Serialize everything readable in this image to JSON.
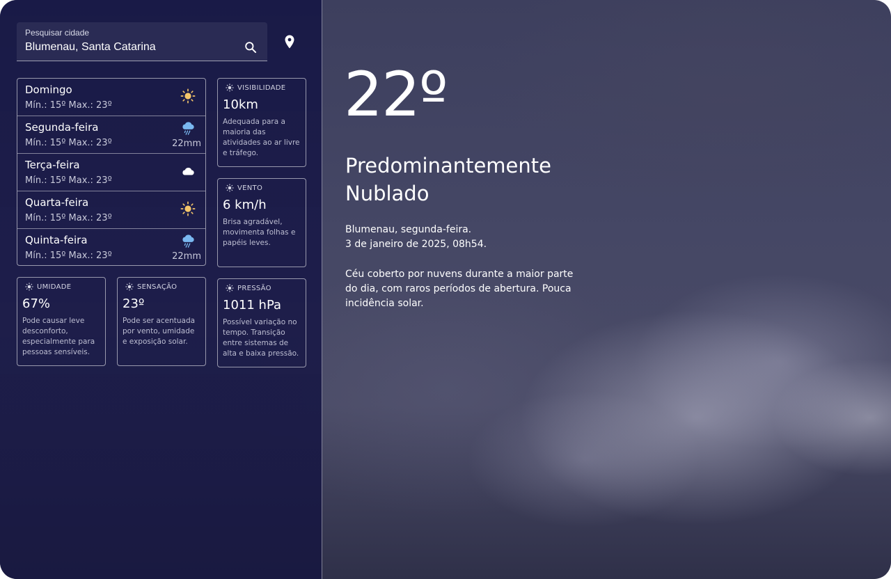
{
  "search": {
    "label": "Pesquisar cidade",
    "value": "Blumenau, Santa Catarina"
  },
  "forecast": [
    {
      "day": "Domingo",
      "temps": "Mín.: 15º Max.: 23º",
      "icon": "sun-icon",
      "rain": ""
    },
    {
      "day": "Segunda-feira",
      "temps": "Mín.: 15º Max.: 23º",
      "icon": "rain-cloud-icon",
      "rain": "22mm"
    },
    {
      "day": "Terça-feira",
      "temps": "Mín.: 15º Max.: 23º",
      "icon": "cloud-icon",
      "rain": ""
    },
    {
      "day": "Quarta-feira",
      "temps": "Mín.: 15º Max.: 23º",
      "icon": "sun-icon",
      "rain": ""
    },
    {
      "day": "Quinta-feira",
      "temps": "Mín.: 15º Max.: 23º",
      "icon": "rain-cloud-icon",
      "rain": "22mm"
    }
  ],
  "cards": {
    "visibility": {
      "title": "VISIBILIDADE",
      "value": "10km",
      "desc": [
        "Adequada para a",
        "maioria das",
        "atividades ao ar livre",
        "e tráfego."
      ]
    },
    "wind": {
      "title": "VENTO",
      "value": "6 km/h",
      "desc": [
        "Brisa agradável,",
        "movimenta folhas e",
        "papéis leves."
      ]
    },
    "humidity": {
      "title": "UMIDADE",
      "value": "67%",
      "desc": [
        "Pode causar leve",
        "desconforto,",
        "especialmente para",
        "pessoas sensíveis."
      ]
    },
    "feels_like": {
      "title": "SENSAÇÃO",
      "value": "23º",
      "desc": [
        "Pode ser acentuada",
        "por vento, umidade",
        "e exposição solar."
      ]
    },
    "pressure": {
      "title": "PRESSÃO",
      "value": "1011 hPa",
      "desc": [
        "Possível variação no",
        "tempo. Transição",
        "entre sistemas de",
        "alta e baixa pressão."
      ]
    }
  },
  "current": {
    "temperature": "22º",
    "condition_line1": "Predominantemente",
    "condition_line2": "Nublado",
    "location_line1": "Blumenau, segunda-feira.",
    "location_line2": "3 de janeiro de 2025, 08h54.",
    "description_lines": [
      "Céu coberto por nuvens durante a maior parte",
      "do dia, com raros períodos de abertura. Pouca",
      "incidência solar."
    ]
  },
  "colors": {
    "sun": "#f5c66a",
    "rain_cloud": "#7ab8f0",
    "cloud": "#ffffff"
  }
}
